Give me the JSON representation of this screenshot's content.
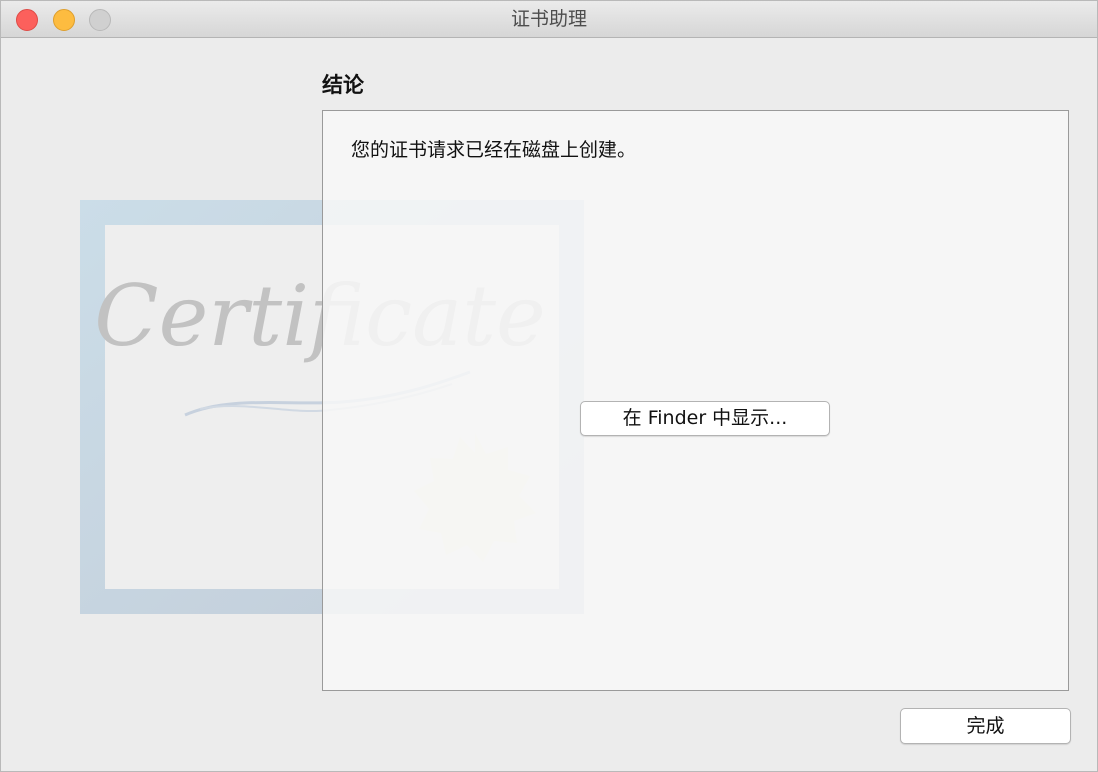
{
  "window": {
    "title": "证书助理",
    "controls": {
      "close_color": "#fc605c",
      "minimize_color": "#fdbc40",
      "zoom_color": "#d0d0d0"
    }
  },
  "main": {
    "section_title": "结论",
    "message": "您的证书请求已经在磁盘上创建。",
    "finder_button_label": "在 Finder 中显示..."
  },
  "footer": {
    "done_button_label": "完成"
  },
  "artwork": {
    "certificate_text": "Certificate"
  }
}
